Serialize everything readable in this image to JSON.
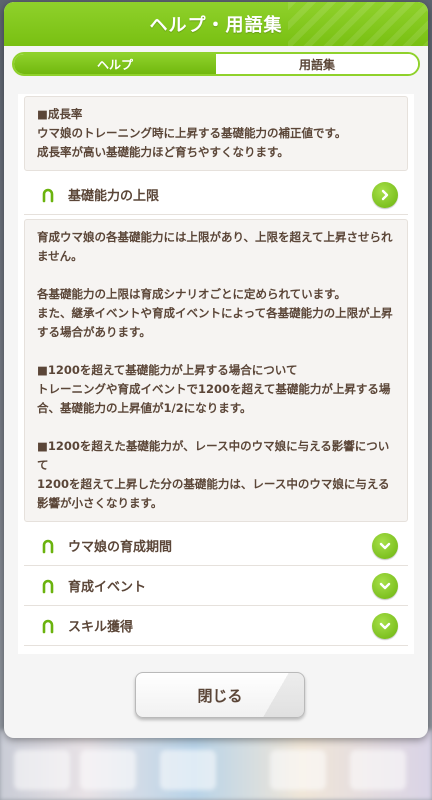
{
  "dialog": {
    "title": "ヘルプ・用語集"
  },
  "tabs": [
    {
      "label": "ヘルプ",
      "active": true
    },
    {
      "label": "用語集",
      "active": false
    }
  ],
  "growth_box": {
    "heading": "■成長率",
    "body": "ウマ娘のトレーニング時に上昇する基礎能力の補正値です。\n成長率が高い基礎能力ほど育ちやすくなります。"
  },
  "sections": [
    {
      "label": "基礎能力の上限",
      "expanded": true
    },
    {
      "label": "ウマ娘の育成期間",
      "expanded": false
    },
    {
      "label": "育成イベント",
      "expanded": false
    },
    {
      "label": "スキル獲得",
      "expanded": false
    }
  ],
  "limit_box": {
    "p1": "育成ウマ娘の各基礎能力には上限があり、上限を超えて上昇させられません。",
    "p2": "各基礎能力の上限は育成シナリオごとに定められています。\nまた、継承イベントや育成イベントによって各基礎能力の上限が上昇する場合があります。",
    "p3": "■1200を超えて基礎能力が上昇する場合について\nトレーニングや育成イベントで1200を超えて基礎能力が上昇する場合、基礎能力の上昇値が1/2になります。",
    "p4": "■1200を超えた基礎能力が、レース中のウマ娘に与える影響について\n1200を超えて上昇した分の基礎能力は、レース中のウマ娘に与える影響が小さくなります。"
  },
  "footer": {
    "close_label": "閉じる"
  },
  "colors": {
    "accent": "#8fd12b",
    "text": "#5b4638"
  }
}
